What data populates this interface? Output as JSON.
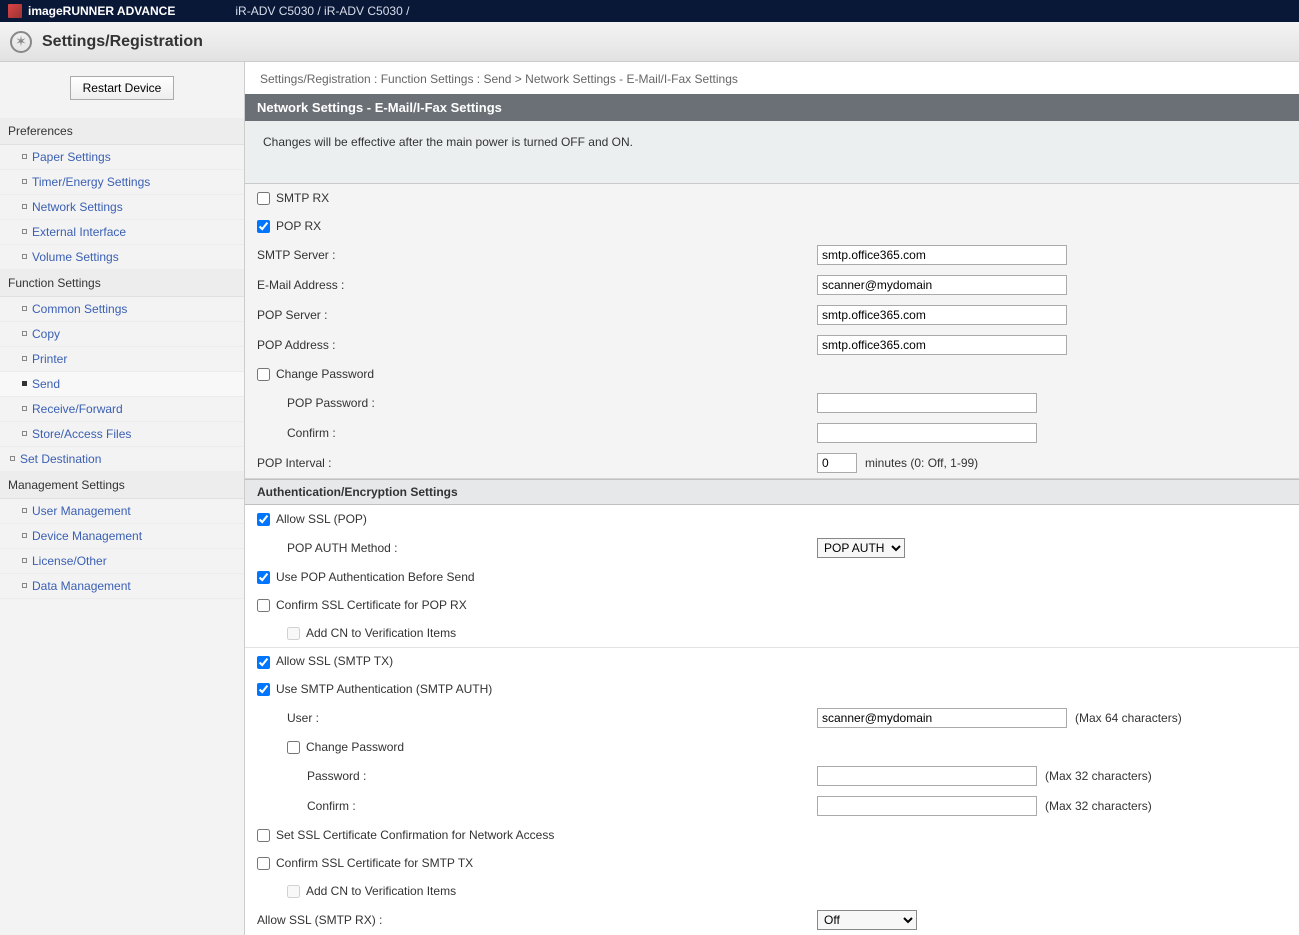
{
  "topbar": {
    "brand": "imageRUNNER ADVANCE",
    "model": "iR-ADV C5030 / iR-ADV C5030 /"
  },
  "subbar": {
    "title": "Settings/Registration"
  },
  "sidebar": {
    "restart_label": "Restart Device",
    "sections": {
      "preferences": {
        "title": "Preferences",
        "items": [
          "Paper Settings",
          "Timer/Energy Settings",
          "Network Settings",
          "External Interface",
          "Volume Settings"
        ]
      },
      "function": {
        "title": "Function Settings",
        "items": [
          "Common Settings",
          "Copy",
          "Printer",
          "Send",
          "Receive/Forward",
          "Store/Access Files"
        ],
        "active": "Send"
      },
      "set_destination": "Set Destination",
      "management": {
        "title": "Management Settings",
        "items": [
          "User Management",
          "Device Management",
          "License/Other",
          "Data Management"
        ]
      }
    }
  },
  "breadcrumb": "Settings/Registration : Function Settings : Send > Network Settings - E-Mail/I-Fax Settings",
  "panel": {
    "title": "Network Settings - E-Mail/I-Fax Settings",
    "notice": "Changes will be effective after the main power is turned OFF and ON."
  },
  "form": {
    "smtp_rx": "SMTP RX",
    "pop_rx": "POP RX",
    "smtp_server_label": "SMTP Server :",
    "smtp_server_value": "smtp.office365.com",
    "email_label": "E-Mail Address :",
    "email_value": "scanner@mydomain",
    "pop_server_label": "POP Server :",
    "pop_server_value": "smtp.office365.com",
    "pop_address_label": "POP Address :",
    "pop_address_value": "smtp.office365.com",
    "change_pw_label": "Change Password",
    "pop_pw_label": "POP Password :",
    "confirm_label": "Confirm :",
    "pop_interval_label": "POP Interval :",
    "pop_interval_value": "0",
    "pop_interval_hint": "minutes (0: Off, 1-99)"
  },
  "auth": {
    "section_title": "Authentication/Encryption Settings",
    "allow_ssl_pop": "Allow SSL (POP)",
    "pop_auth_method_label": "POP AUTH Method :",
    "pop_auth_method_value": "POP AUTH",
    "use_pop_before_send": "Use POP Authentication Before Send",
    "confirm_ssl_pop_rx": "Confirm SSL Certificate for POP RX",
    "add_cn1": "Add CN to Verification Items",
    "allow_ssl_smtp_tx": "Allow SSL (SMTP TX)",
    "use_smtp_auth": "Use SMTP Authentication (SMTP AUTH)",
    "user_label": "User :",
    "user_value": "scanner@mydomain",
    "user_hint": "(Max 64 characters)",
    "change_pw2": "Change Password",
    "pw_label": "Password :",
    "pw_hint": "(Max 32 characters)",
    "confirm2_label": "Confirm :",
    "confirm2_hint": "(Max 32 characters)",
    "set_ssl_cert_network": "Set SSL Certificate Confirmation for Network Access",
    "confirm_ssl_smtp_tx": "Confirm SSL Certificate for SMTP TX",
    "add_cn2": "Add CN to Verification Items",
    "allow_ssl_smtp_rx_label": "Allow SSL (SMTP RX) :",
    "allow_ssl_smtp_rx_value": "Off"
  }
}
